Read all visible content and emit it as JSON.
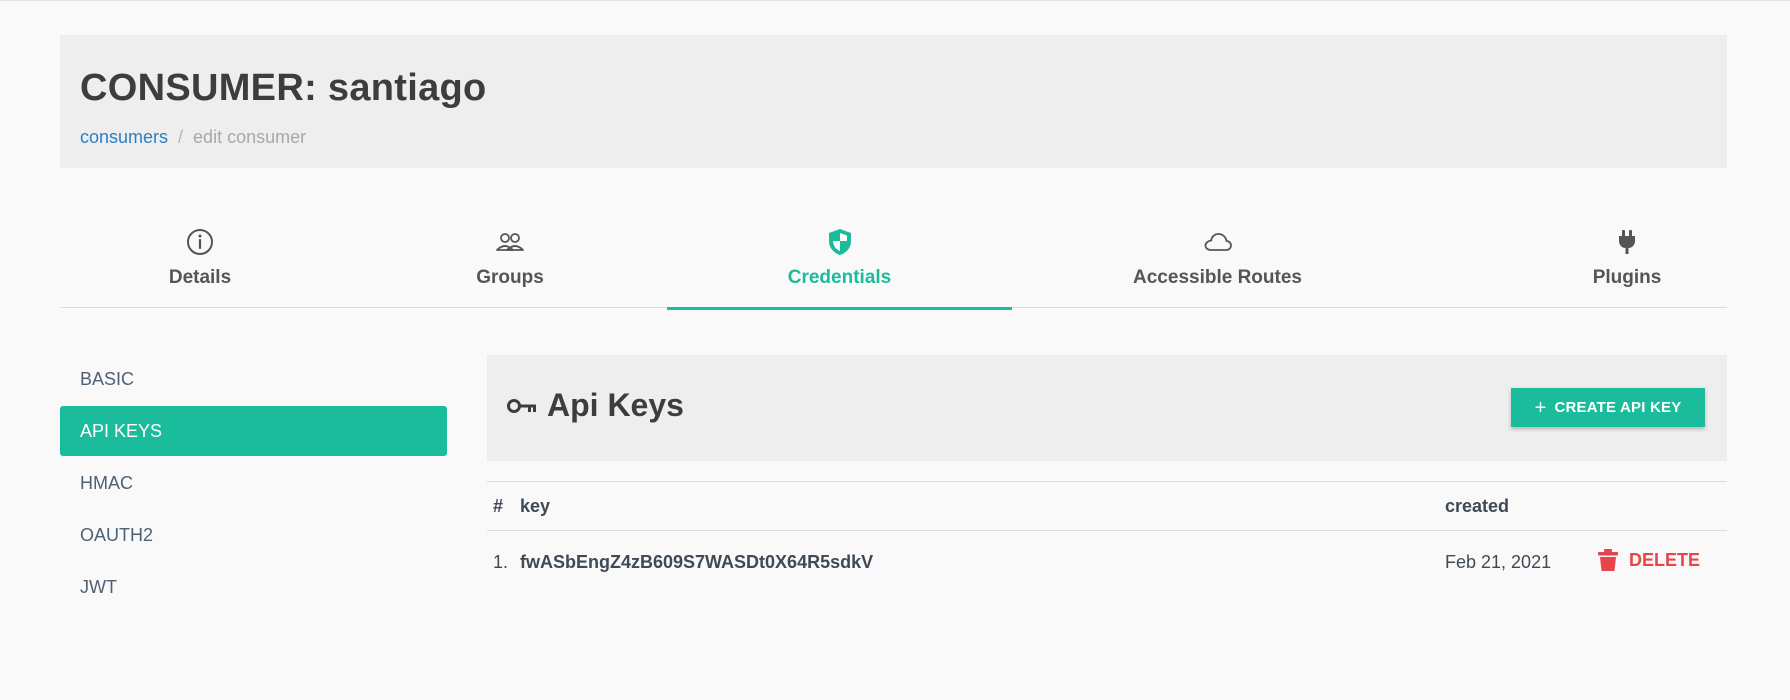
{
  "page": {
    "title": "CONSUMER: santiago",
    "breadcrumb": {
      "link": "consumers",
      "separator": "/",
      "current": "edit consumer"
    }
  },
  "tabs": [
    {
      "label": "Details",
      "icon": "info-icon"
    },
    {
      "label": "Groups",
      "icon": "users-icon"
    },
    {
      "label": "Credentials",
      "icon": "shield-icon",
      "active": true
    },
    {
      "label": "Accessible Routes",
      "icon": "cloud-icon"
    },
    {
      "label": "Plugins",
      "icon": "plug-icon"
    }
  ],
  "sidebar": {
    "items": [
      {
        "label": "BASIC"
      },
      {
        "label": "API KEYS",
        "active": true
      },
      {
        "label": "HMAC"
      },
      {
        "label": "OAUTH2"
      },
      {
        "label": "JWT"
      }
    ]
  },
  "panel": {
    "title": "Api Keys",
    "icon": "key-icon",
    "create_label": "CREATE API KEY"
  },
  "table": {
    "headers": {
      "num": "#",
      "key": "key",
      "created": "created"
    },
    "rows": [
      {
        "num": "1.",
        "key": "fwASbEngZ4zB609S7WASDt0X64R5sdkV",
        "created": "Feb 21, 2021",
        "action": "DELETE"
      }
    ]
  },
  "colors": {
    "accent": "#1bbc9b",
    "link": "#2d7fc1",
    "danger": "#e8454a",
    "header_bg": "#eeeeee"
  }
}
